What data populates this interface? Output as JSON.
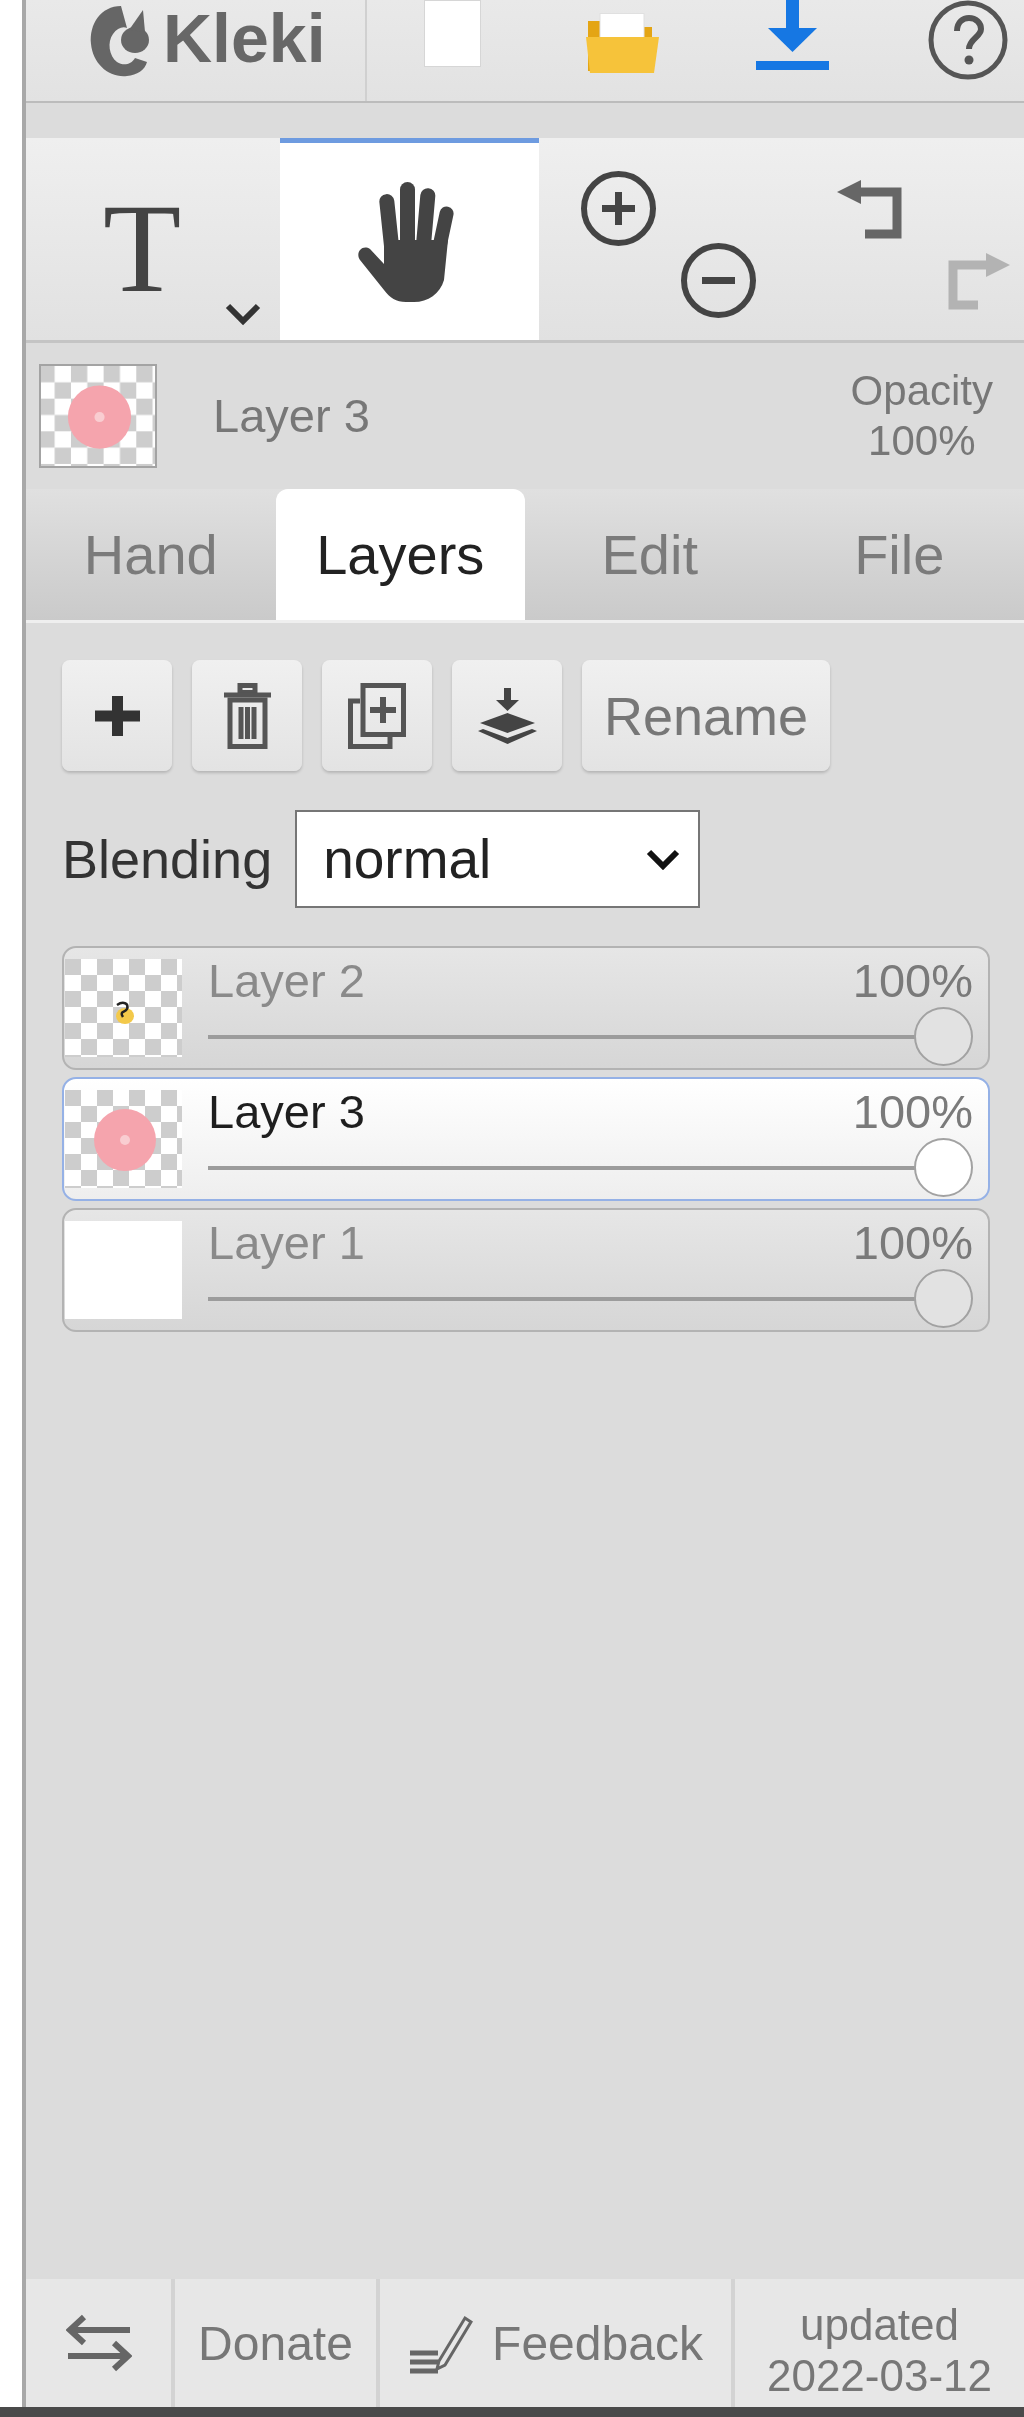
{
  "top_bar": {
    "logo": "Kleki"
  },
  "toolbar": {
    "tools": [
      {
        "kind": "text",
        "label": "T",
        "selected": false
      },
      {
        "kind": "hand",
        "selected": true
      }
    ],
    "history": [
      {
        "kind": "undo",
        "disabled": false
      },
      {
        "kind": "redo",
        "disabled": true
      }
    ]
  },
  "current_layer": {
    "name": "Layer 3",
    "kind": "circle",
    "opacity_label": "Opacity",
    "opacity": "100%"
  },
  "tabs": [
    {
      "label": "Hand",
      "selected": false
    },
    {
      "label": "Layers",
      "selected": true
    },
    {
      "label": "Edit",
      "selected": false
    },
    {
      "label": "File",
      "selected": false
    }
  ],
  "layer_actions": {
    "rename": "Rename"
  },
  "blending": {
    "label": "Blending",
    "value": "normal"
  },
  "layers": [
    {
      "kind": "sketch",
      "name": "Layer 2",
      "opacity": "100%",
      "level": 1,
      "selected": false
    },
    {
      "kind": "circle",
      "name": "Layer 3",
      "opacity": "100%",
      "level": 1,
      "selected": true
    },
    {
      "kind": "blank",
      "name": "Layer 1",
      "opacity": "100%",
      "level": 1,
      "selected": false
    }
  ],
  "footer": {
    "donate": "Donate",
    "feedback": "Feedback",
    "updated": "updated 2022-03-12"
  }
}
